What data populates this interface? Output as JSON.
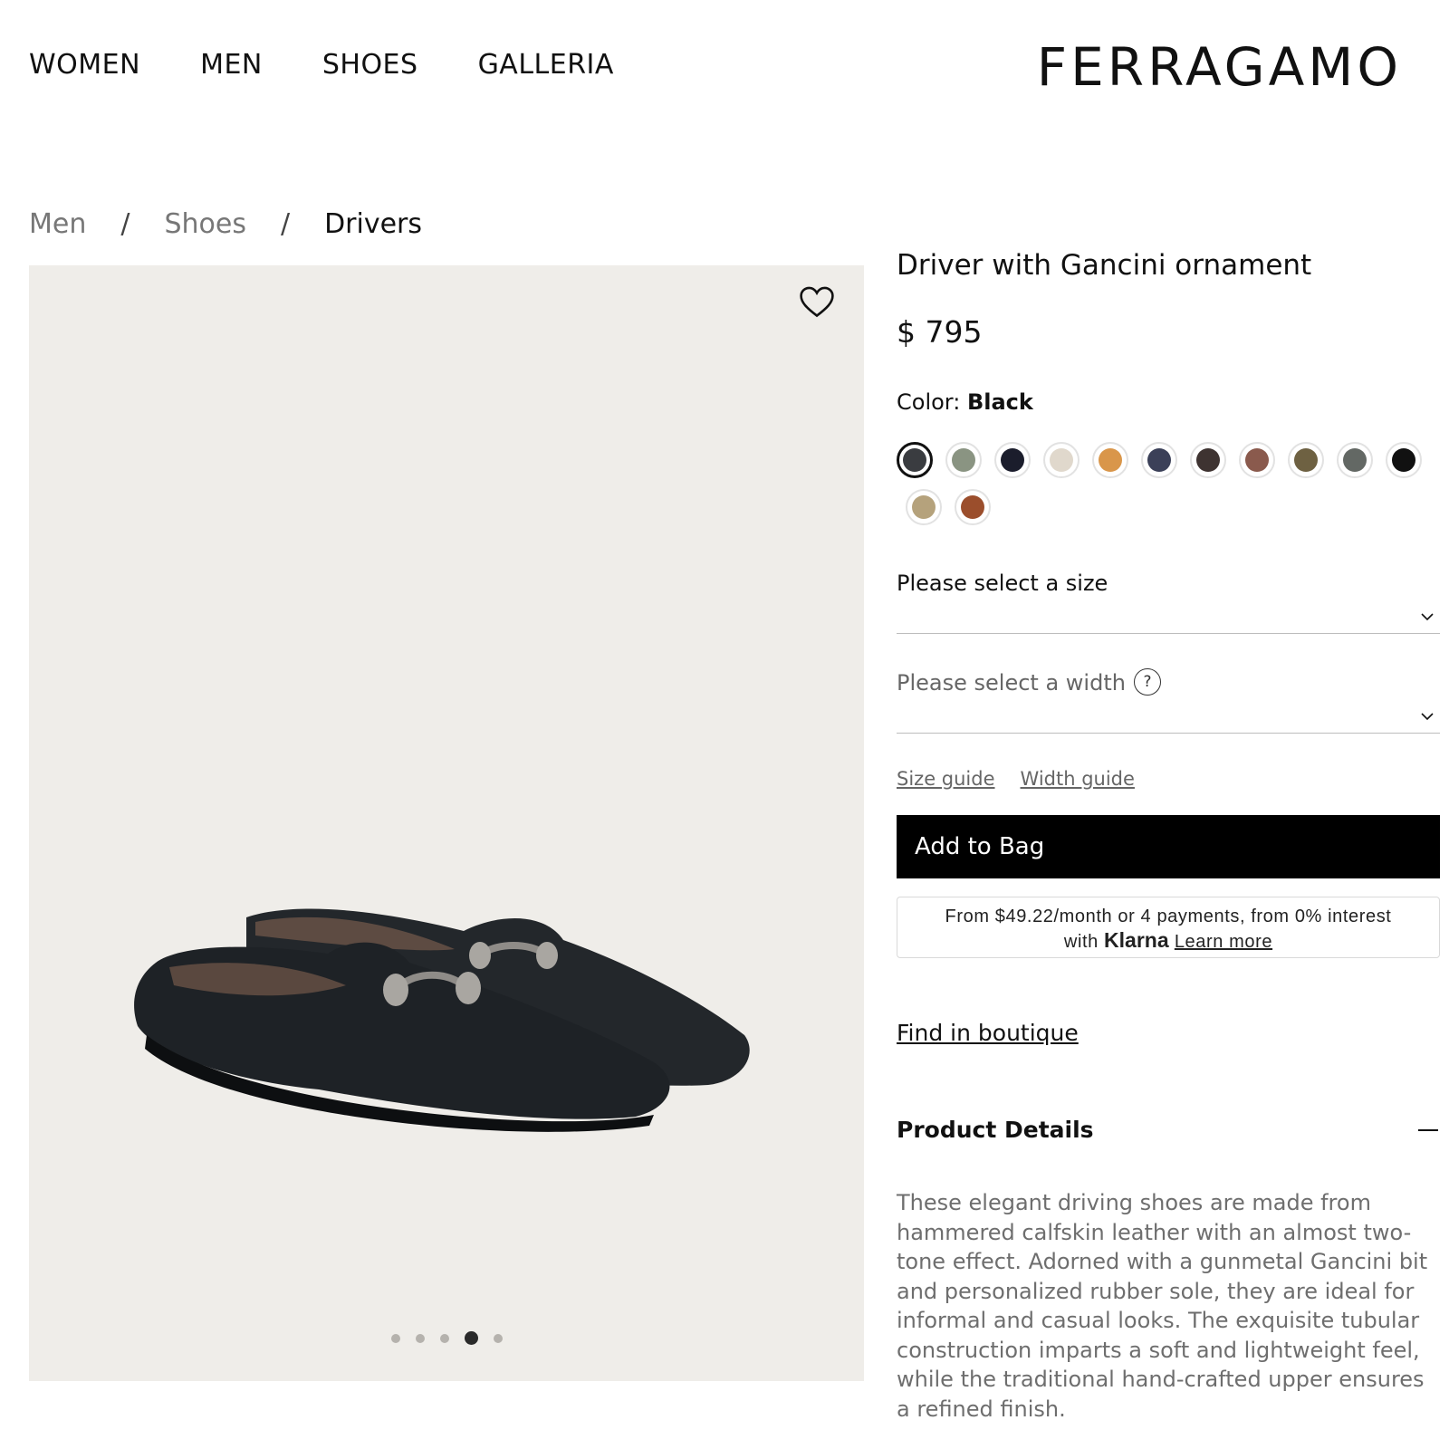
{
  "nav": {
    "items": [
      "WOMEN",
      "MEN",
      "SHOES",
      "GALLERIA"
    ],
    "brand": "FERRAGAMO"
  },
  "breadcrumb": {
    "items": [
      "Men",
      "Shoes",
      "Drivers"
    ],
    "separator": "/"
  },
  "gallery": {
    "wishlist_icon": "heart-icon",
    "slide_count": 5,
    "active_slide": 4
  },
  "product": {
    "title": "Driver with Gancini ornament",
    "price": "$ 795",
    "color_label": "Color: ",
    "color_value": "Black",
    "swatches": [
      {
        "hex": "#3a3c40",
        "selected": true
      },
      {
        "hex": "#8a9482",
        "selected": false
      },
      {
        "hex": "#1b1d2c",
        "selected": false
      },
      {
        "hex": "#e0d8cc",
        "selected": false
      },
      {
        "hex": "#d9964a",
        "selected": false
      },
      {
        "hex": "#3b4058",
        "selected": false
      },
      {
        "hex": "#3e3331",
        "selected": false
      },
      {
        "hex": "#8a5a4d",
        "selected": false
      },
      {
        "hex": "#6e6142",
        "selected": false
      },
      {
        "hex": "#636864",
        "selected": false
      },
      {
        "hex": "#111111",
        "selected": false
      },
      {
        "hex": "#b5a27c",
        "selected": false
      },
      {
        "hex": "#9b4e2c",
        "selected": false
      }
    ]
  },
  "size_select": {
    "label": "Please select a size",
    "icon": "chevron-down-icon"
  },
  "width_select": {
    "label": "Please select a width",
    "help": "?",
    "icon": "chevron-down-icon"
  },
  "guides": {
    "size": "Size guide",
    "width": "Width guide"
  },
  "add_to_bag": "Add to Bag",
  "klarna": {
    "line1": "From $49.22/month or 4 payments, from 0% interest",
    "with": "with",
    "brand": "Klarna",
    "learn_more": "Learn more"
  },
  "find_boutique": "Find in boutique",
  "details": {
    "heading": "Product Details",
    "description": "These elegant driving shoes are made from hammered calfskin leather with an almost two-tone effect. Adorned with a gunmetal Gancini bit and personalized rubber sole, they are ideal for informal and casual looks. The exquisite tubular construction imparts a soft and lightweight feel, while the traditional hand-crafted upper ensures a refined finish."
  }
}
